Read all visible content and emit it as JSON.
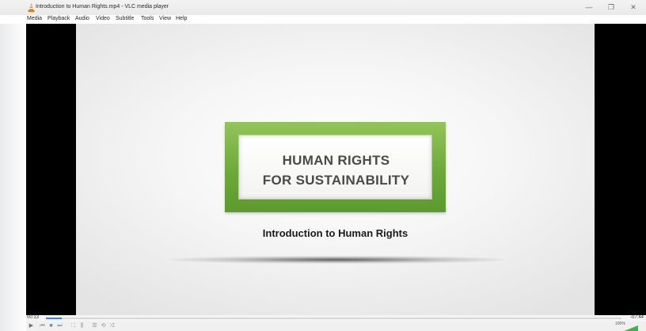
{
  "window": {
    "title": "Introduction to Human Rights.mp4 - VLC media player",
    "icon": "vlc-cone-icon",
    "controls": {
      "minimize": "—",
      "maximize": "❐",
      "close": "✕"
    }
  },
  "menu": {
    "items": [
      "Media",
      "Playback",
      "Audio",
      "Video",
      "Subtitle",
      "Tools",
      "View",
      "Help"
    ]
  },
  "video": {
    "headline_line1": "HUMAN RIGHTS",
    "headline_line2": "FOR SUSTAINABILITY",
    "subtitle": "Introduction to Human Rights"
  },
  "playback": {
    "elapsed": "00:13",
    "remaining": "-07:44",
    "progress_fraction": 0.027,
    "volume_label": "100%",
    "volume_fraction": 1.0
  },
  "controls": {
    "play": "▶",
    "previous": "⏮",
    "stop": "■",
    "next": "⏭",
    "fullscreen": "⛶",
    "extended_settings": "⫼",
    "playlist": "☰",
    "loop": "⟲",
    "shuffle": "⤮"
  },
  "colors": {
    "accent": "#3a86d8",
    "logo_green": "#6ea93a"
  }
}
